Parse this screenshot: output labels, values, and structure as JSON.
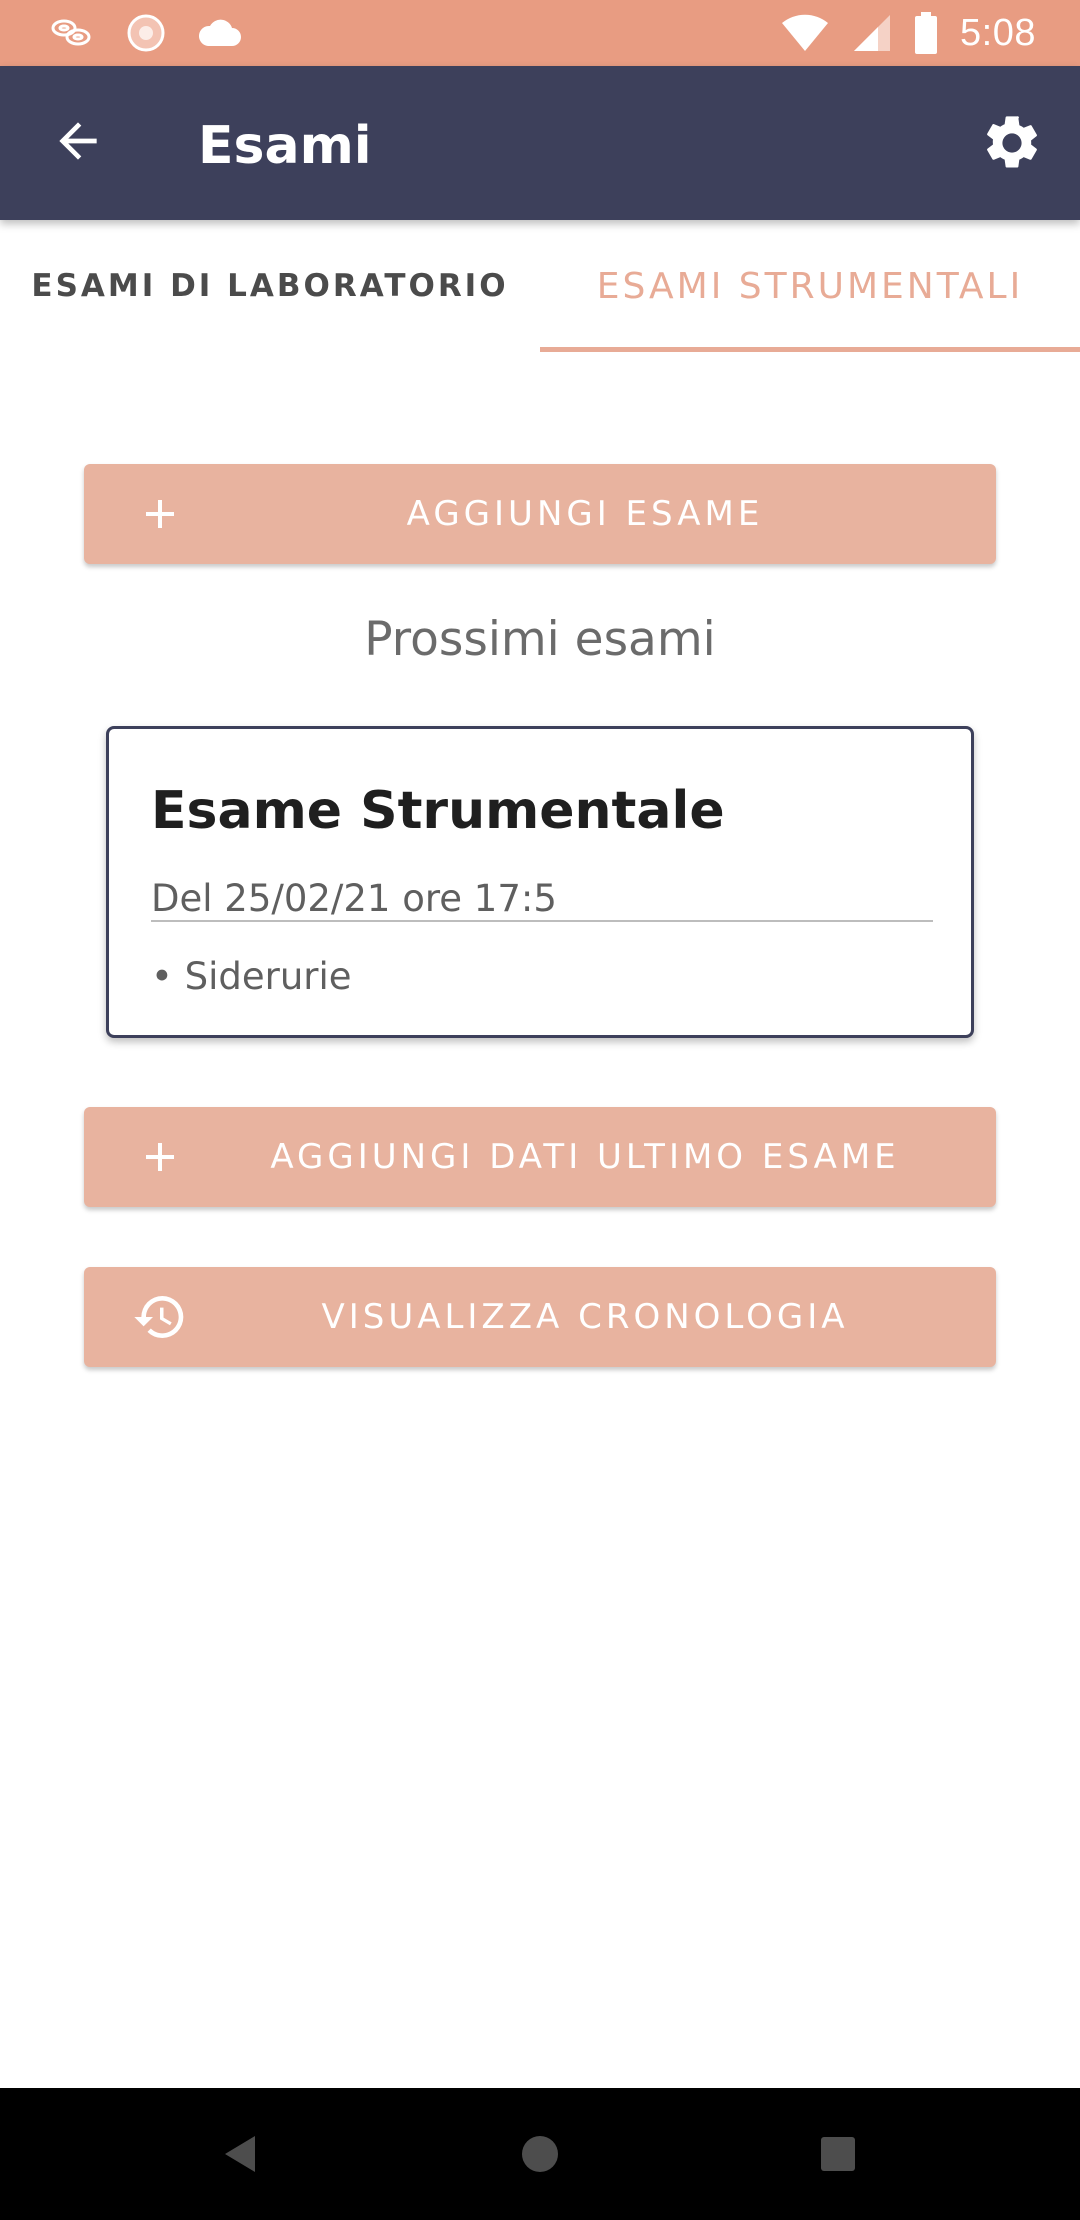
{
  "status_bar": {
    "time": "5:08",
    "icons": [
      "notification-app-icon",
      "flower-app-icon",
      "cloud-icon",
      "wifi-icon",
      "cell-signal-icon",
      "battery-icon"
    ]
  },
  "app_bar": {
    "title": "Esami",
    "back_icon": "arrow-left-icon",
    "settings_icon": "gear-icon"
  },
  "tabs": [
    {
      "label": "ESAMI DI LABORATORIO",
      "selected": false
    },
    {
      "label": "ESAMI STRUMENTALI",
      "selected": true
    }
  ],
  "buttons": {
    "add_exam": {
      "label": "AGGIUNGI ESAME",
      "icon": "plus-icon"
    },
    "add_last_exam_data": {
      "label": "AGGIUNGI DATI ULTIMO ESAME",
      "icon": "plus-icon"
    },
    "view_history": {
      "label": "VISUALIZZA CRONOLOGIA",
      "icon": "history-icon"
    }
  },
  "upcoming": {
    "section_title": "Prossimi esami",
    "card": {
      "title": "Esame Strumentale",
      "date": "Del 25/02/21 ore 17:5",
      "items": [
        "• Siderurie"
      ]
    }
  },
  "colors": {
    "status_bar": "#e89c82",
    "app_bar": "#3d405b",
    "accent": "#e8ab96",
    "button": "#e8b39f",
    "card_border": "#3d405b"
  }
}
